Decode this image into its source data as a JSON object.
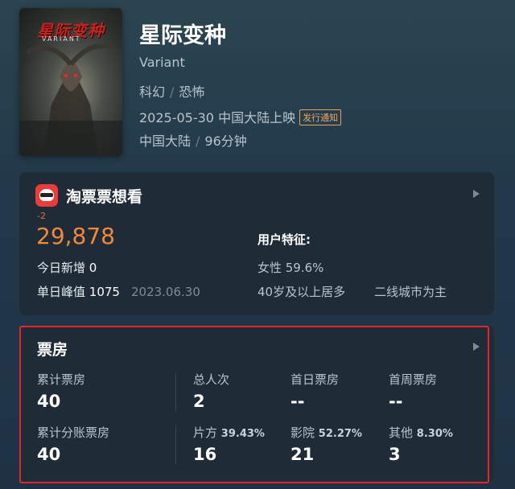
{
  "movie": {
    "poster_title": "星际变种",
    "poster_subtitle": "VARIANT",
    "title": "星际变种",
    "english_title": "Variant",
    "genres": [
      "科幻",
      "恐怖"
    ],
    "release": "2025-05-30 中国大陆上映",
    "release_badge": "发行通知",
    "region": "中国大陆",
    "duration": "96分钟"
  },
  "taopiaopiao": {
    "title": "淘票票想看",
    "delta": "-2",
    "want_count": "29,878",
    "today_new_label": "今日新增",
    "today_new_value": "0",
    "peak_label": "单日峰值",
    "peak_value": "1075",
    "peak_date": "2023.06.30",
    "features_title": "用户特征:",
    "gender": "女性 59.6%",
    "age": "40岁及以上居多",
    "city": "二线城市为主"
  },
  "box_office": {
    "title": "票房",
    "row1": [
      {
        "label": "累计票房",
        "value": "40"
      },
      {
        "label": "总人次",
        "value": "2"
      },
      {
        "label": "首日票房",
        "value": "--"
      },
      {
        "label": "首周票房",
        "value": "--"
      }
    ],
    "row2": [
      {
        "label": "累计分账票房",
        "pct": "",
        "value": "40"
      },
      {
        "label": "片方",
        "pct": "39.43%",
        "value": "16"
      },
      {
        "label": "影院",
        "pct": "52.27%",
        "value": "21"
      },
      {
        "label": "其他",
        "pct": "8.30%",
        "value": "3"
      }
    ]
  },
  "colors": {
    "accent_orange": "#f08a3a",
    "highlight_red": "#e3262a",
    "badge_orange": "#f0a664"
  }
}
